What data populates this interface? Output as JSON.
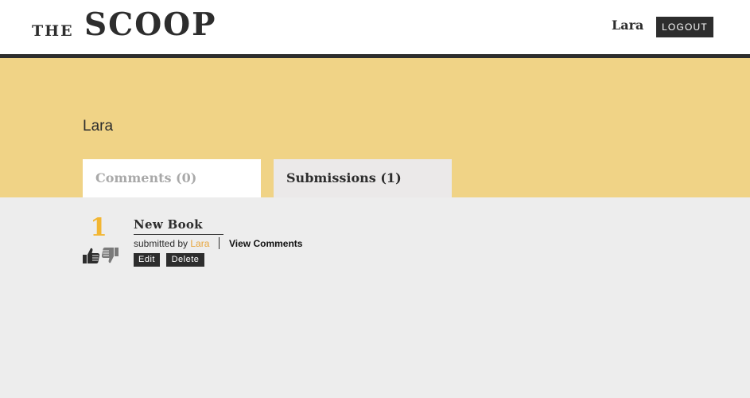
{
  "header": {
    "logo_the": "THE",
    "logo_scoop": "SCOOP",
    "username": "Lara",
    "logout_label": "LOGOUT"
  },
  "profile": {
    "name": "Lara"
  },
  "tabs": [
    {
      "label": "Comments (0)",
      "active": false
    },
    {
      "label": "Submissions (1)",
      "active": true
    }
  ],
  "submissions": [
    {
      "votes": "1",
      "title": "New Book",
      "submitted_by_prefix": "submitted by",
      "author": "Lara",
      "view_comments_label": "View Comments",
      "edit_label": "Edit",
      "delete_label": "Delete",
      "upvote_icon": "thumbs-up-icon",
      "downvote_icon": "thumbs-down-icon"
    }
  ],
  "colors": {
    "dark": "#2d2d2d",
    "hero": "#f0d386",
    "accent": "#f2b632",
    "author_link": "#e8a53a",
    "background": "#ededed"
  }
}
